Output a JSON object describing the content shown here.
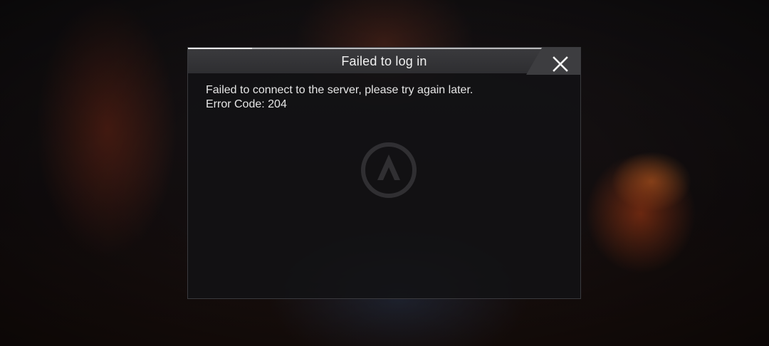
{
  "dialog": {
    "title": "Failed to log in",
    "message": "Failed to connect to the server, please try again later.",
    "error_line": "Error Code: 204",
    "close_icon": "close-icon"
  },
  "colors": {
    "dialog_background": "#121214",
    "header_background": "#36363a",
    "text": "#e6e6e6"
  }
}
